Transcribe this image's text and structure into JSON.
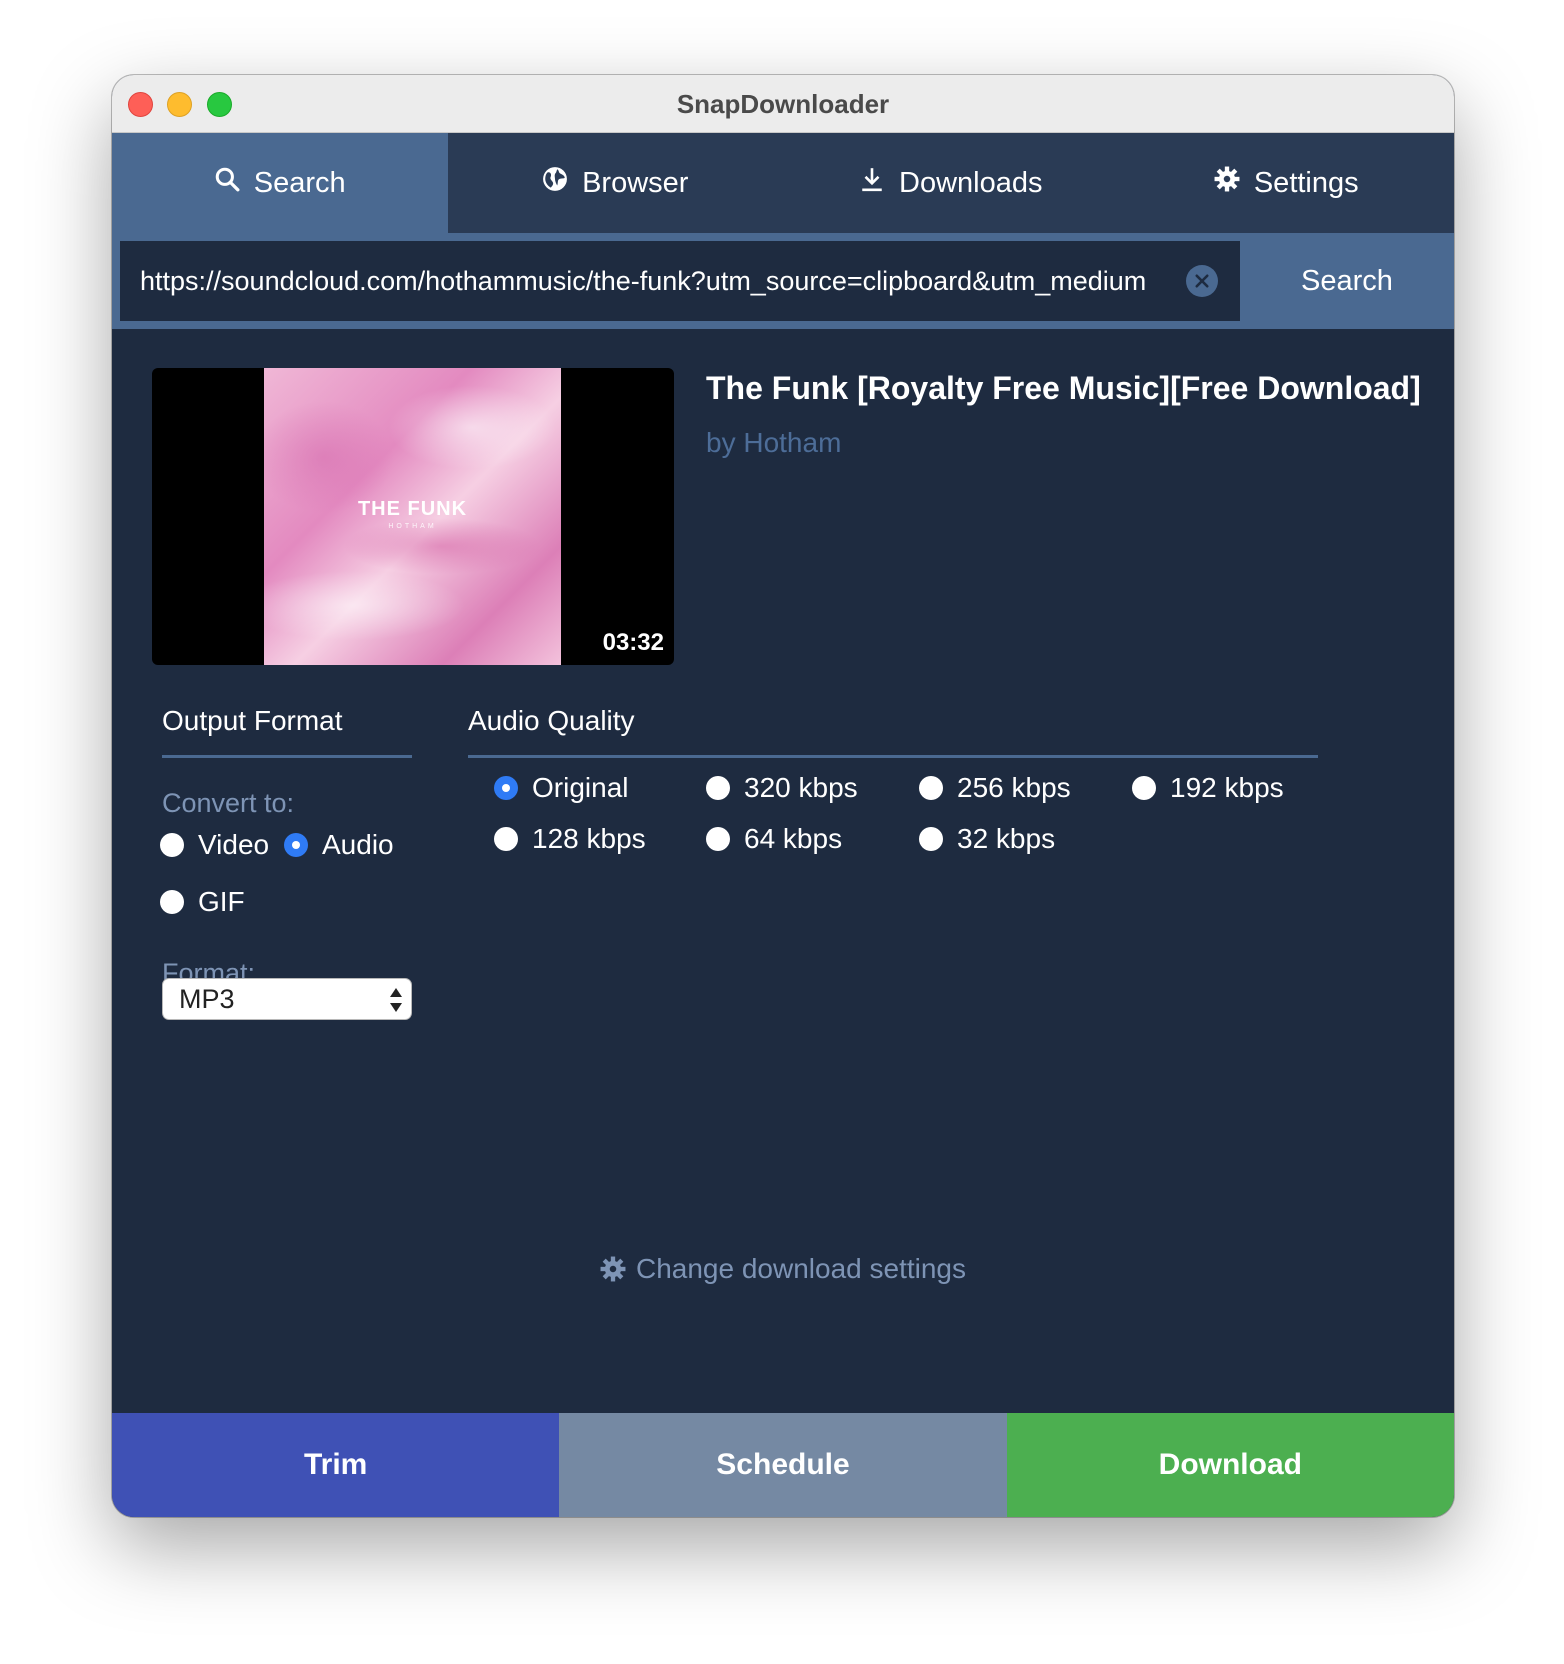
{
  "window": {
    "title": "SnapDownloader"
  },
  "tabs": [
    {
      "label": "Search",
      "icon": "search-icon",
      "active": true
    },
    {
      "label": "Browser",
      "icon": "globe-icon",
      "active": false
    },
    {
      "label": "Downloads",
      "icon": "download-icon",
      "active": false
    },
    {
      "label": "Settings",
      "icon": "gear-icon",
      "active": false
    }
  ],
  "search": {
    "url": "https://soundcloud.com/hothammusic/the-funk?utm_source=clipboard&utm_medium",
    "button_label": "Search"
  },
  "media": {
    "title": "The Funk [Royalty Free Music][Free Download]",
    "author": "by Hotham",
    "duration": "03:32",
    "art_title": "THE FUNK",
    "art_subtitle": "HOTHAM"
  },
  "output_format": {
    "title": "Output Format",
    "convert_label": "Convert to:",
    "options": [
      "Video",
      "Audio",
      "GIF"
    ],
    "selected": "Audio",
    "format_label": "Format:",
    "format_value": "MP3"
  },
  "audio_quality": {
    "title": "Audio Quality",
    "options": [
      "Original",
      "320 kbps",
      "256 kbps",
      "192 kbps",
      "128 kbps",
      "64 kbps",
      "32 kbps"
    ],
    "selected": "Original"
  },
  "change_settings_label": "Change download settings",
  "bottom": {
    "trim_label": "Trim",
    "schedule_label": "Schedule",
    "download_label": "Download"
  },
  "colors": {
    "background": "#1e2b40",
    "tab_bar": "#2a3b55",
    "accent": "#4a6991",
    "trim": "#3f51b5",
    "schedule": "#7589a3",
    "download": "#4caf50",
    "radio_checked": "#2f7bf5"
  }
}
